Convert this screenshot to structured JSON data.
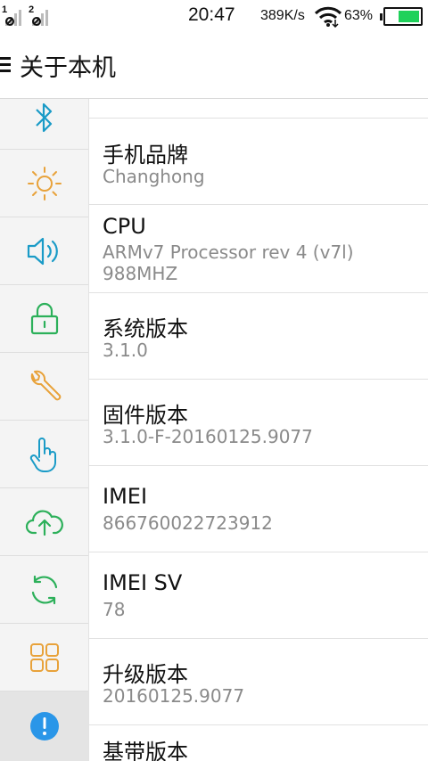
{
  "status_bar": {
    "sim1": "1",
    "sim2": "2",
    "time": "20:47",
    "net_speed": "389K/s",
    "battery_percent": "63%",
    "battery_level": 0.63,
    "battery_color": "#1fd15a"
  },
  "header": {
    "title": "关于本机"
  },
  "sidebar": {
    "items": [
      {
        "icon": "bluetooth-icon",
        "color": "#1a9bc7"
      },
      {
        "icon": "brightness-icon",
        "color": "#e8a23a"
      },
      {
        "icon": "sound-icon",
        "color": "#1a9bc7"
      },
      {
        "icon": "lock-icon",
        "color": "#2cb05a"
      },
      {
        "icon": "wrench-icon",
        "color": "#e8a23a"
      },
      {
        "icon": "touch-icon",
        "color": "#1a9bc7"
      },
      {
        "icon": "cloud-upload-icon",
        "color": "#2cb05a"
      },
      {
        "icon": "sync-icon",
        "color": "#2cb05a"
      },
      {
        "icon": "apps-grid-icon",
        "color": "#e8a23a"
      },
      {
        "icon": "info-icon",
        "color": "#2a96e8",
        "active": true
      }
    ]
  },
  "list": {
    "items": [
      {
        "label": "手机品牌",
        "value": "Changhong"
      },
      {
        "label": "CPU",
        "value": "ARMv7 Processor rev 4 (v7l)\n988MHZ"
      },
      {
        "label": "系统版本",
        "value": "3.1.0"
      },
      {
        "label": "固件版本",
        "value": "3.1.0-F-20160125.9077"
      },
      {
        "label": "IMEI",
        "value": "866760022723912"
      },
      {
        "label": "IMEI SV",
        "value": "78"
      },
      {
        "label": "升级版本",
        "value": "20160125.9077"
      },
      {
        "label": "基带版本",
        "value": ""
      }
    ]
  }
}
